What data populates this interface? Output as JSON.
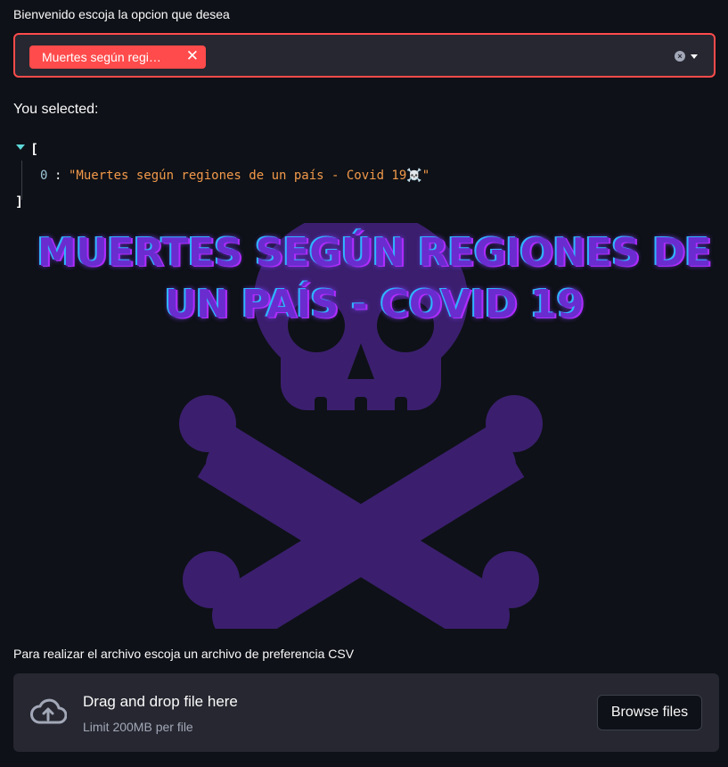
{
  "select": {
    "label": "Bienvenido escoja la opcion que desea",
    "selected_tag": "Muertes según regi…",
    "tag_close": "✕",
    "clear_icon": "×",
    "accent_color": "#ff4b4b"
  },
  "output": {
    "heading": "You selected:",
    "json_open": "[",
    "json_close": "]",
    "items": [
      {
        "index": "0",
        "colon": ":",
        "value": "\"Muertes según regiones de un país - Covid 19☠️\""
      }
    ]
  },
  "banner": {
    "title": "MUERTES SEGÚN REGIONES DE UN PAÍS - COVID 19",
    "image_icon": "skull-crossbones-icon",
    "image_color": "#3b1f6e"
  },
  "uploader": {
    "label": "Para realizar el archivo escoja un archivo de preferencia CSV",
    "drop_title": "Drag and drop file here",
    "drop_limit": "Limit 200MB per file",
    "browse_label": "Browse files",
    "icon": "cloud-upload-icon"
  }
}
